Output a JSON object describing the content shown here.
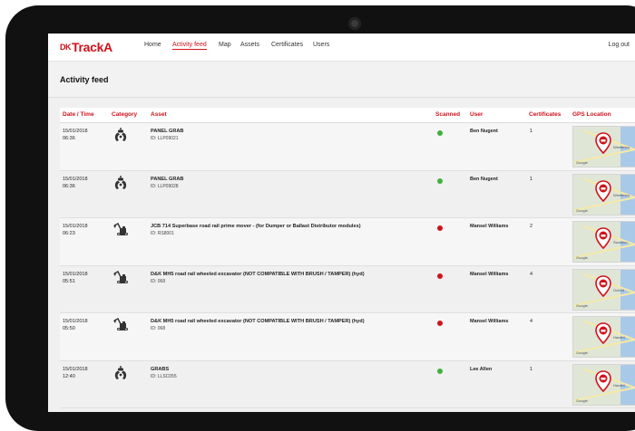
{
  "nav": {
    "logo_mark": "DK",
    "logo_text": "TrackA",
    "items": [
      "Home",
      "Activity feed",
      "Map",
      "Assets",
      "Certificates",
      "Users"
    ],
    "active": "Activity feed",
    "logout": "Log out"
  },
  "page": {
    "title": "Activity feed"
  },
  "table": {
    "headers": [
      "Date / Time",
      "Category",
      "Asset",
      "Scanned",
      "User",
      "Certificates",
      "GPS Location"
    ],
    "rows": [
      {
        "date": "15/01/2018",
        "time": "06:36",
        "category_icon": "grab-icon",
        "asset": "PANEL GRAB",
        "asset_id": "ID: LLP09021",
        "scanned": "green",
        "user": "Ben Nugent",
        "certificates": "1",
        "map_town": "Westerloo"
      },
      {
        "date": "15/01/2018",
        "time": "06:36",
        "category_icon": "grab-icon",
        "asset": "PANEL GRAB",
        "asset_id": "ID: LLP09028",
        "scanned": "green",
        "user": "Ben Nugent",
        "certificates": "1",
        "map_town": "Westerloo"
      },
      {
        "date": "15/01/2018",
        "time": "06:23",
        "category_icon": "excavator-icon",
        "asset": "JCB 714 Superbase road rail prime mover - (for Dumper or Ballast Distributor modules)",
        "asset_id": "ID: RS8001",
        "scanned": "red",
        "user": "Mansel Williams",
        "certificates": "2",
        "map_town": "Swanton"
      },
      {
        "date": "15/01/2018",
        "time": "05:51",
        "category_icon": "excavator-icon",
        "asset": "D&K MH5 road rail wheeled excavator (NOT COMPATIBLE WITH BRUSH / TAMPER) (hyd)",
        "asset_id": "ID: 068",
        "scanned": "red",
        "user": "Mansel Williams",
        "certificates": "4",
        "map_town": "Oxford"
      },
      {
        "date": "15/01/2018",
        "time": "05:50",
        "category_icon": "excavator-icon",
        "asset": "D&K MH5 road rail wheeled excavator (NOT COMPATIBLE WITH BRUSH / TAMPER) (hyd)",
        "asset_id": "ID: 068",
        "scanned": "red",
        "user": "Mansel Williams",
        "certificates": "4",
        "map_town": "Havant"
      },
      {
        "date": "15/01/2018",
        "time": "12:40",
        "category_icon": "grab-icon",
        "asset": "GRABS",
        "asset_id": "ID: LLSC055",
        "scanned": "green",
        "user": "Lee Allen",
        "certificates": "1",
        "map_town": "Havant"
      }
    ]
  },
  "colors": {
    "accent": "#d0121b",
    "scanned_yes": "#3db33d",
    "scanned_no": "#d0121b"
  },
  "map_attribution": "Google"
}
